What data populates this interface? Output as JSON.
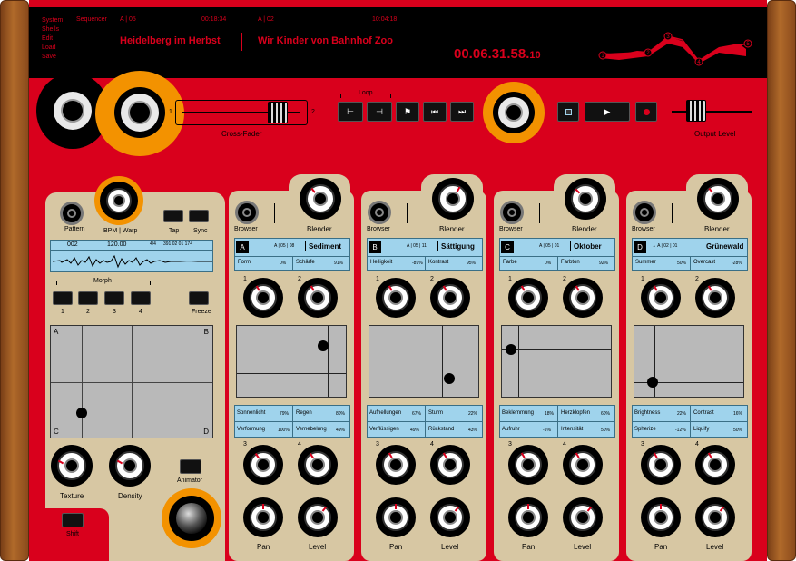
{
  "header": {
    "menu": [
      "System",
      "Shells",
      "Edit",
      "Load",
      "Save"
    ],
    "sequencer_label": "Sequencer",
    "track_a_pos": "A | 05",
    "track_a_time": "00:18:34",
    "track_b_pos": "A | 02",
    "track_b_time": "10:04:18",
    "track_a_title": "Heidelberg im Herbst",
    "track_b_title": "Wir Kinder von Bahnhof Zoo",
    "clock_main": "00.06.31.58.",
    "clock_frac": "10",
    "env_points": [
      "1",
      "2",
      "3",
      "4",
      "5"
    ]
  },
  "transport": {
    "loop_label": "Loop",
    "crossfader_label": "Cross-Fader",
    "cf_left": "1",
    "cf_right": "2",
    "output_label": "Output Level"
  },
  "left_panel": {
    "pattern_label": "Pattern",
    "bpm_label": "BPM | Warp",
    "tap_label": "Tap",
    "sync_label": "Sync",
    "lcd_pattern": "002",
    "lcd_bpm": "120.00",
    "lcd_sig": "4/4",
    "lcd_pos": "391  02  01  174",
    "morph_label": "Morph",
    "morph_buttons": [
      "1",
      "2",
      "3",
      "4"
    ],
    "freeze_label": "Freeze",
    "corners": [
      "A",
      "B",
      "C",
      "D"
    ],
    "texture_label": "Texture",
    "density_label": "Density",
    "animator_label": "Animator",
    "shift_label": "Shift"
  },
  "channels": [
    {
      "browser": "Browser",
      "blender": "Blender",
      "letter": "A",
      "nav": "A | 05 | 08",
      "preset": "Sediment",
      "p1": "Form",
      "v1": "0%",
      "p2": "Schärfe",
      "v2": "91%",
      "b1": "Sonnenlicht",
      "bv1": "79%",
      "b2": "Regen",
      "bv2": "80%",
      "b3": "Verformung",
      "bv3": "100%",
      "b4": "Vernebelung",
      "bv4": "49%",
      "k1": "1",
      "k2": "2",
      "k3": "3",
      "k4": "4",
      "pan": "Pan",
      "level": "Level"
    },
    {
      "browser": "Browser",
      "blender": "Blender",
      "letter": "B",
      "nav": "A | 05 | 11",
      "preset": "Sättigung",
      "p1": "Helligkeit",
      "v1": "-89%",
      "p2": "Kontrast",
      "v2": "95%",
      "b1": "Aufhellungen",
      "bv1": "67%",
      "b2": "Sturm",
      "bv2": "22%",
      "b3": "Verflüssigen",
      "bv3": "49%",
      "b4": "Rückstand",
      "bv4": "43%",
      "k1": "1",
      "k2": "2",
      "k3": "3",
      "k4": "4",
      "pan": "Pan",
      "level": "Level"
    },
    {
      "browser": "Browser",
      "blender": "Blender",
      "letter": "C",
      "nav": "A | 05 | 01",
      "preset": "Oktober",
      "p1": "Farbe",
      "v1": "0%",
      "p2": "Farbton",
      "v2": "92%",
      "b1": "Beklemmung",
      "bv1": "18%",
      "b2": "Herzklopfen",
      "bv2": "60%",
      "b3": "Aufruhr",
      "bv3": "-5%",
      "b4": "Intensität",
      "bv4": "50%",
      "k1": "1",
      "k2": "2",
      "k3": "3",
      "k4": "4",
      "pan": "Pan",
      "level": "Level"
    },
    {
      "browser": "Browser",
      "blender": "Blender",
      "letter": "D",
      "nav": "→  A | 02 | 01",
      "preset": "Grünewald",
      "p1": "Summer",
      "v1": "50%",
      "p2": "Overcast",
      "v2": "-28%",
      "b1": "Brightness",
      "bv1": "22%",
      "b2": "Contrast",
      "bv2": "16%",
      "b3": "Spherize",
      "bv3": "-12%",
      "b4": "Liquify",
      "bv4": "50%",
      "k1": "1",
      "k2": "2",
      "k3": "3",
      "k4": "4",
      "pan": "Pan",
      "level": "Level"
    }
  ],
  "colors": {
    "red": "#d9001c",
    "orange": "#f39200",
    "beige": "#d7c7a3",
    "lcd": "#9fd3ec"
  }
}
